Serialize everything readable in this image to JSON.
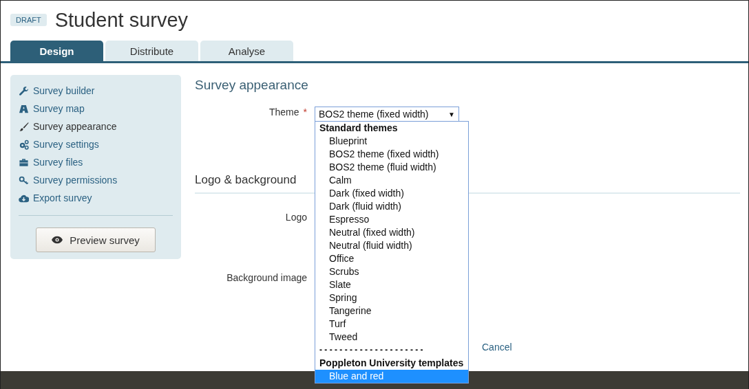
{
  "header": {
    "badge": "DRAFT",
    "title": "Student survey"
  },
  "tabs": [
    {
      "label": "Design",
      "selected": true
    },
    {
      "label": "Distribute",
      "selected": false
    },
    {
      "label": "Analyse",
      "selected": false
    }
  ],
  "sidebar": {
    "items": [
      {
        "label": "Survey builder",
        "selected": false
      },
      {
        "label": "Survey map",
        "selected": false
      },
      {
        "label": "Survey appearance",
        "selected": true
      },
      {
        "label": "Survey settings",
        "selected": false
      },
      {
        "label": "Survey files",
        "selected": false
      },
      {
        "label": "Survey permissions",
        "selected": false
      },
      {
        "label": "Export survey",
        "selected": false
      }
    ],
    "preview_button": "Preview survey"
  },
  "content": {
    "heading": "Survey appearance",
    "theme": {
      "label": "Theme",
      "required_mark": "*",
      "value": "BOS2 theme (fixed width)",
      "caret": "▼",
      "options": [
        {
          "kind": "group",
          "label": "Standard themes"
        },
        {
          "kind": "option",
          "label": "Blueprint",
          "highlighted": false
        },
        {
          "kind": "option",
          "label": "BOS2 theme (fixed width)",
          "highlighted": false
        },
        {
          "kind": "option",
          "label": "BOS2 theme (fluid width)",
          "highlighted": false
        },
        {
          "kind": "option",
          "label": "Calm",
          "highlighted": false
        },
        {
          "kind": "option",
          "label": "Dark (fixed width)",
          "highlighted": false
        },
        {
          "kind": "option",
          "label": "Dark (fluid width)",
          "highlighted": false
        },
        {
          "kind": "option",
          "label": "Espresso",
          "highlighted": false
        },
        {
          "kind": "option",
          "label": "Neutral (fixed width)",
          "highlighted": false
        },
        {
          "kind": "option",
          "label": "Neutral (fluid width)",
          "highlighted": false
        },
        {
          "kind": "option",
          "label": "Office",
          "highlighted": false
        },
        {
          "kind": "option",
          "label": "Scrubs",
          "highlighted": false
        },
        {
          "kind": "option",
          "label": "Slate",
          "highlighted": false
        },
        {
          "kind": "option",
          "label": "Spring",
          "highlighted": false
        },
        {
          "kind": "option",
          "label": "Tangerine",
          "highlighted": false
        },
        {
          "kind": "option",
          "label": "Turf",
          "highlighted": false
        },
        {
          "kind": "option",
          "label": "Tweed",
          "highlighted": false
        },
        {
          "kind": "separator",
          "label": "- - - - - - - - - - - - - - - - - - - - -"
        },
        {
          "kind": "group",
          "label": "Poppleton University templates"
        },
        {
          "kind": "option",
          "label": "Blue and red",
          "highlighted": true
        }
      ]
    },
    "section": "Logo & background",
    "fields": [
      {
        "label": "Logo"
      },
      {
        "label": "Background image"
      }
    ],
    "cancel": "Cancel"
  }
}
